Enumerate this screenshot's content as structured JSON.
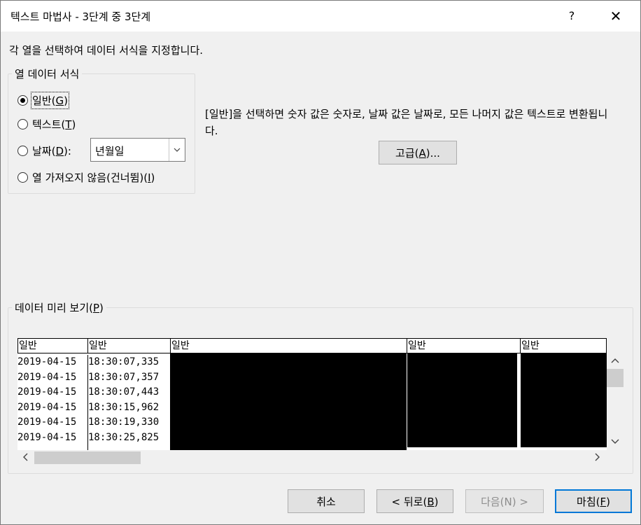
{
  "window": {
    "title": "텍스트 마법사 - 3단계 중 3단계",
    "help_glyph": "?",
    "close_glyph": "✕"
  },
  "instruction": "각 열을 선택하여 데이터 서식을 지정합니다.",
  "column_format": {
    "legend": "열 데이터 서식",
    "options": [
      {
        "label": "일반",
        "key": "G",
        "checked": true
      },
      {
        "label": "텍스트",
        "key": "T",
        "checked": false
      },
      {
        "label": "날짜",
        "key": "D",
        "checked": false
      },
      {
        "label": "열 가져오지 않음(건너뜀)",
        "key": "I",
        "checked": false
      }
    ],
    "date_colon": ":",
    "date_value": "년월일"
  },
  "description": "[일반]을 선택하면 숫자 값은 숫자로, 날짜 값은 날짜로, 모든 나머지 값은 텍스트로 변환됩니다.",
  "advanced_button": {
    "label": "고급",
    "key": "A",
    "suffix": "..."
  },
  "preview": {
    "legend": "데이터 미리 보기",
    "legend_key": "P",
    "columns": [
      {
        "header": "일반",
        "cells": [
          "2019-04-15",
          "2019-04-15",
          "2019-04-15",
          "2019-04-15",
          "2019-04-15",
          "2019-04-15"
        ]
      },
      {
        "header": "일반",
        "cells": [
          "18:30:07,335",
          "18:30:07,357",
          "18:30:07,443",
          "18:30:15,962",
          "18:30:19,330",
          "18:30:25,825"
        ]
      },
      {
        "header": "일반",
        "cells": []
      },
      {
        "header": "일반",
        "cells": []
      },
      {
        "header": "일반",
        "cells": []
      }
    ]
  },
  "buttons": {
    "cancel": "취소",
    "back": "< 뒤로",
    "back_key": "B",
    "next": "다음(N) >",
    "finish": "마침",
    "finish_key": "F"
  }
}
